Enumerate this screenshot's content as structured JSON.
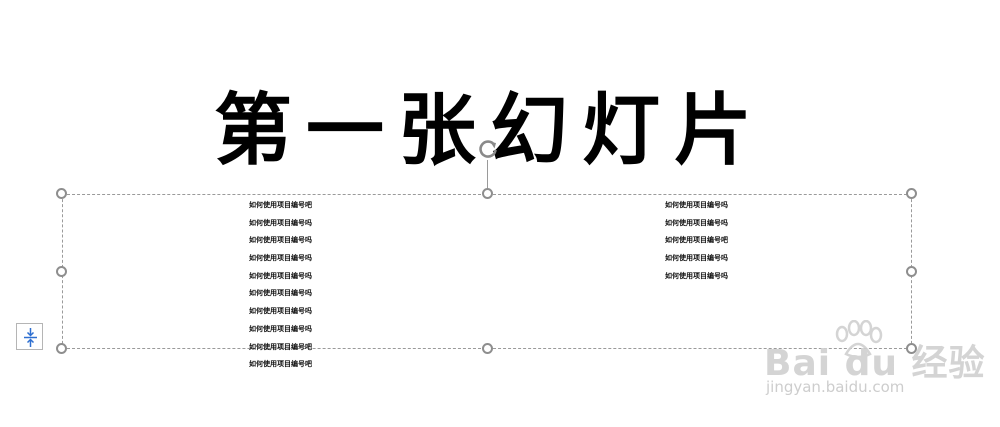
{
  "slide": {
    "title": "第一张幻灯片",
    "columns": {
      "left": [
        "如何使用项目编号吧",
        "如何使用项目编号吗",
        "如何使用项目编号吗",
        "如何使用项目编号吗",
        "如何使用项目编号吗",
        "如何使用项目编号吗",
        "如何使用项目编号吗",
        "如何使用项目编号吗",
        "如何使用项目编号吧",
        "如何使用项目编号吧"
      ],
      "right": [
        "如何使用项目编号吗",
        "如何使用项目编号吗",
        "如何使用项目编号吧",
        "如何使用项目编号吗",
        "如何使用项目编号吗"
      ]
    }
  },
  "controls": {
    "rotate_icon": "rotate-icon",
    "autofit_icon": "autofit-icon"
  },
  "watermark": {
    "logo": "Bai du 经验",
    "site": "jingyan.baidu.com"
  }
}
